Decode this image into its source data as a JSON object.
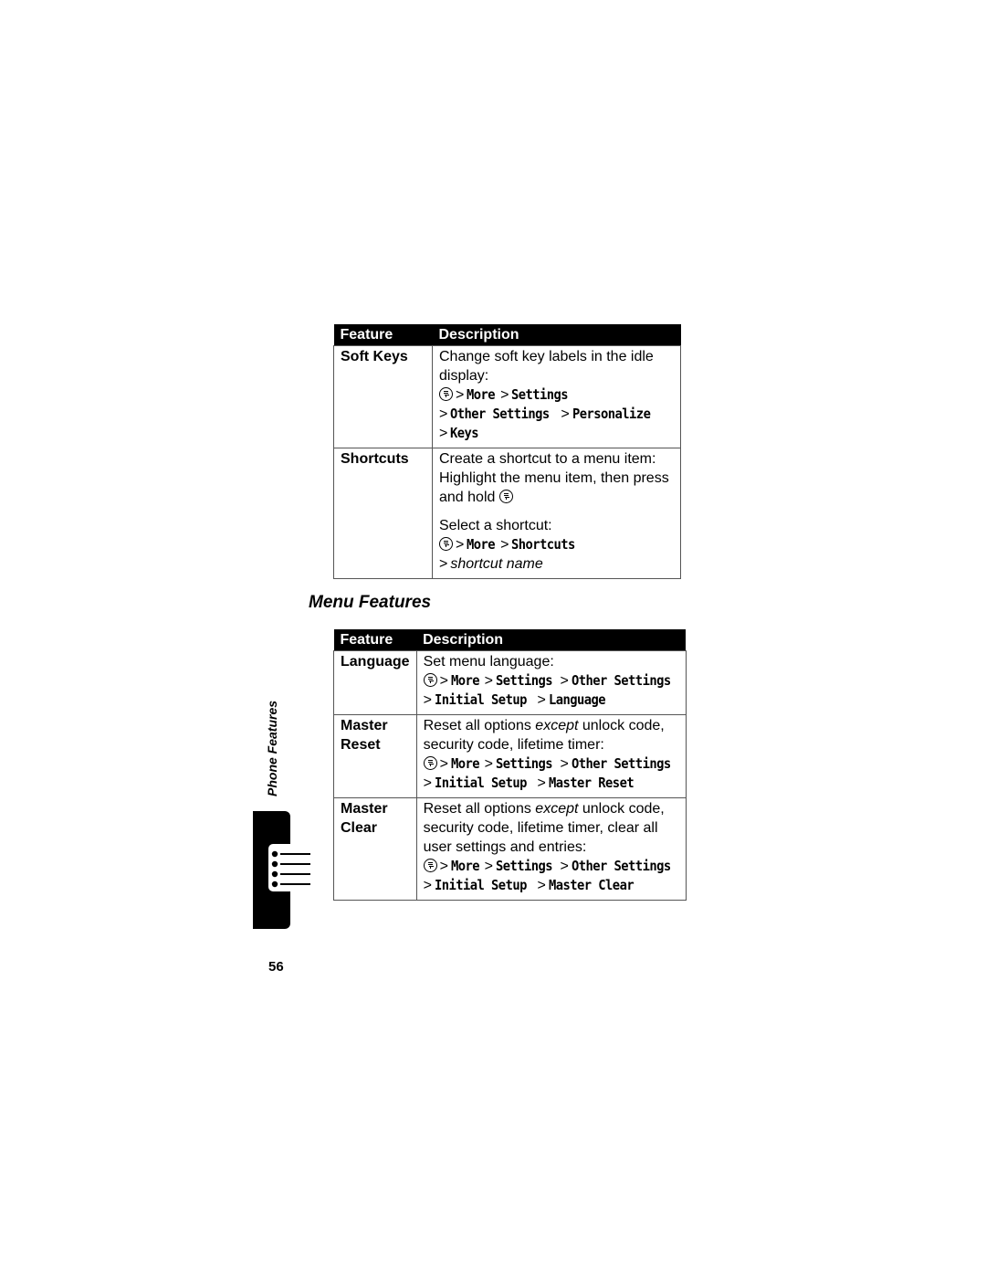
{
  "table1": {
    "headers": [
      "Feature",
      "Description"
    ],
    "rows": [
      {
        "feature": "Soft Keys",
        "text": "Change soft key labels in the idle display:",
        "path_line1": [
          "More",
          "Settings"
        ],
        "path_line2": [
          "Other Settings",
          "Personalize"
        ],
        "path_line3": [
          "Keys"
        ]
      },
      {
        "feature": "Shortcuts",
        "text": "Create a shortcut to a menu item: Highlight the menu item, then press and hold",
        "text2": "Select a shortcut:",
        "path_line1": [
          "More",
          "Shortcuts"
        ],
        "path_line2_italic": "shortcut name"
      }
    ]
  },
  "section_title": "Menu Features",
  "table2": {
    "headers": [
      "Feature",
      "Description"
    ],
    "rows": [
      {
        "feature": "Language",
        "text": "Set menu language:",
        "path_line1": [
          "More",
          "Settings",
          "Other Settings"
        ],
        "path_line2": [
          "Initial Setup",
          "Language"
        ]
      },
      {
        "feature_line1": "Master",
        "feature_line2": "Reset",
        "text_pre": "Reset all options ",
        "text_em": "except",
        "text_post": " unlock code, security code, lifetime timer:",
        "path_line1": [
          "More",
          "Settings",
          "Other Settings"
        ],
        "path_line2": [
          "Initial Setup",
          "Master Reset"
        ]
      },
      {
        "feature_line1": "Master",
        "feature_line2": "Clear",
        "text_pre": "Reset all options ",
        "text_em": "except",
        "text_post": " unlock code, security code, lifetime timer, clear all user settings and entries:",
        "path_line1": [
          "More",
          "Settings",
          "Other Settings"
        ],
        "path_line2": [
          "Initial Setup",
          "Master Clear"
        ]
      }
    ]
  },
  "separator": ">",
  "side_label": "Phone Features",
  "side_tab_icon": "list-icon",
  "menu_key_icon": "menu-key-icon",
  "page_number": "56"
}
